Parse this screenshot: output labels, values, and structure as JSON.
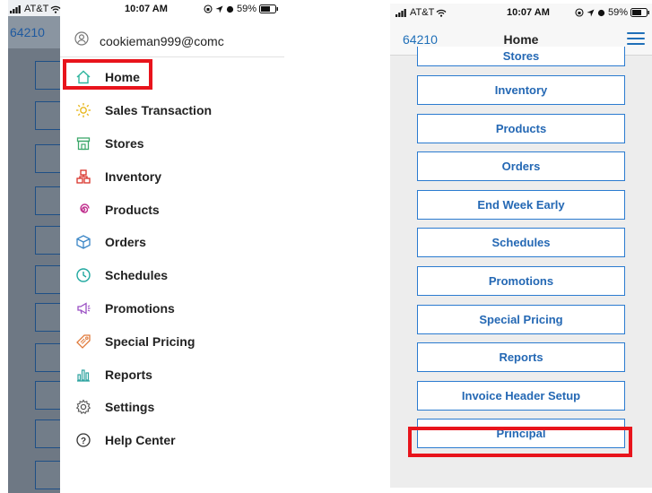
{
  "left_screen": {
    "status_bar": {
      "carrier": "AT&T",
      "time": "10:07 AM",
      "battery": "59%"
    },
    "background_navbar_number": "64210",
    "drawer": {
      "user_email": "cookieman999@comc",
      "menu_items": [
        {
          "label": "Home",
          "icon": "home-icon"
        },
        {
          "label": "Sales Transaction",
          "icon": "sun-icon"
        },
        {
          "label": "Stores",
          "icon": "store-icon"
        },
        {
          "label": "Inventory",
          "icon": "inventory-icon"
        },
        {
          "label": "Products",
          "icon": "spiral-icon"
        },
        {
          "label": "Orders",
          "icon": "box-icon"
        },
        {
          "label": "Schedules",
          "icon": "clock-icon"
        },
        {
          "label": "Promotions",
          "icon": "megaphone-icon"
        },
        {
          "label": "Special Pricing",
          "icon": "tag-icon"
        },
        {
          "label": "Reports",
          "icon": "bar-chart-icon"
        },
        {
          "label": "Settings",
          "icon": "gear-icon"
        },
        {
          "label": "Help Center",
          "icon": "help-icon"
        }
      ]
    }
  },
  "right_screen": {
    "status_bar": {
      "carrier": "AT&T",
      "time": "10:07 AM",
      "battery": "59%"
    },
    "navbar": {
      "number": "64210",
      "title": "Home"
    },
    "buttons": [
      "Stores",
      "Inventory",
      "Products",
      "Orders",
      "End Week Early",
      "Schedules",
      "Promotions",
      "Special Pricing",
      "Reports",
      "Invoice Header Setup",
      "Principal"
    ]
  },
  "colors": {
    "highlight": "#e8141c",
    "accent_blue": "#2468b4",
    "button_border": "#2b7bd0"
  }
}
